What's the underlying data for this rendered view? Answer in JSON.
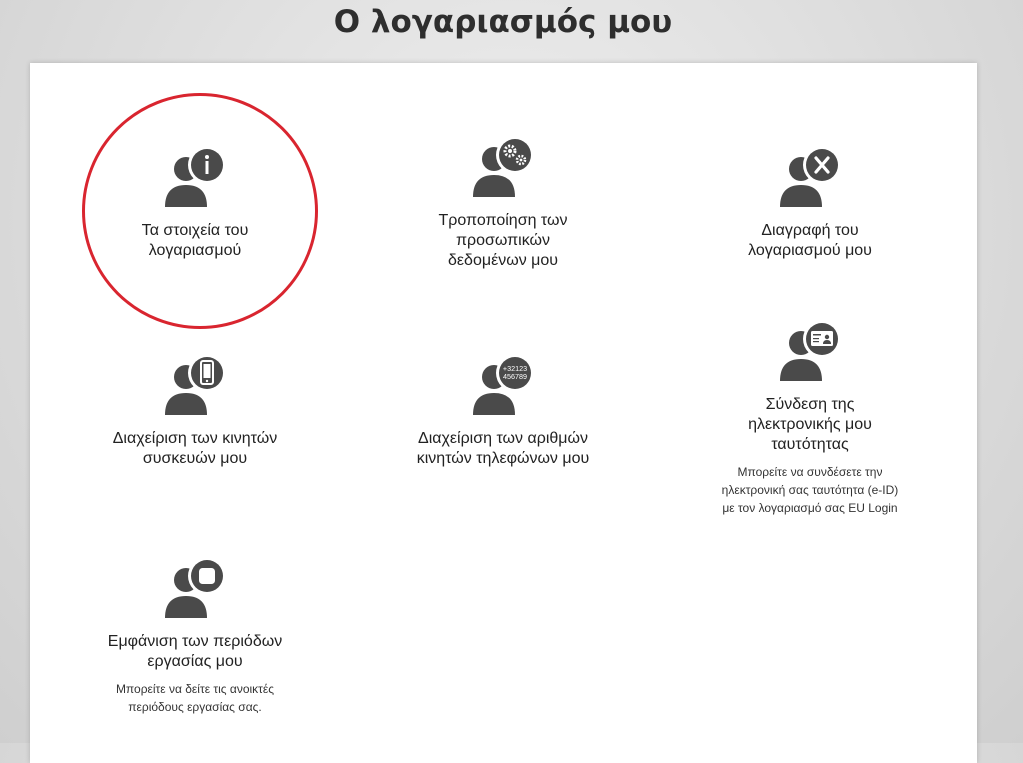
{
  "page": {
    "title": "Ο λογαριασμός μου"
  },
  "tiles": [
    {
      "label_1": "Τα στοιχεία του",
      "label_2": "λογαριασμού",
      "icon": "user-info-icon",
      "badge": "i"
    },
    {
      "label_1": "Τροποποίηση των",
      "label_2": "προσωπικών",
      "label_3": "δεδομένων μου",
      "icon": "user-settings-icon"
    },
    {
      "label_1": "Διαγραφή του",
      "label_2": "λογαριασμού μου",
      "icon": "user-delete-icon",
      "badge": "X"
    },
    {
      "label_1": "Διαχείριση των κινητών",
      "label_2": "συσκευών μου",
      "icon": "user-mobile-icon"
    },
    {
      "label_1": "Διαχείριση των αριθμών",
      "label_2": "κινητών τηλεφώνων μου",
      "icon": "user-phone-numbers-icon",
      "badge_line_1": "+32123",
      "badge_line_2": "456789"
    },
    {
      "label_1": "Σύνδεση της",
      "label_2": "ηλεκτρονικής μου",
      "label_3": "ταυτότητας",
      "icon": "user-eid-icon",
      "desc_1": "Μπορείτε να συνδέσετε την",
      "desc_2": "ηλεκτρονική σας ταυτότητα (e-ID)",
      "desc_3": "με τον λογαριασμό σας EU Login"
    },
    {
      "label_1": "Εμφάνιση των περιόδων",
      "label_2": "εργασίας μου",
      "icon": "user-sessions-icon",
      "desc_1": "Μπορείτε να δείτε τις ανοικτές",
      "desc_2": "περιόδους εργασίας σας."
    }
  ],
  "colors": {
    "icon": "#4a4a4a",
    "highlight": "#d9252f",
    "panel": "#ffffff"
  }
}
